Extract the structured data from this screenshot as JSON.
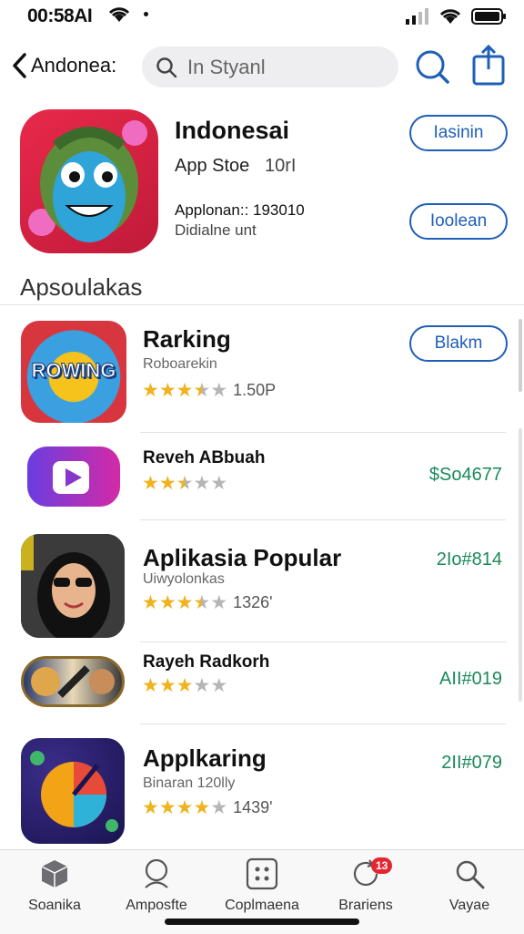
{
  "status_bar": {
    "time": "00:58AI"
  },
  "nav": {
    "back_label": "Andonea:",
    "search_placeholder": "In Styanl"
  },
  "featured": {
    "title": "Indonesai",
    "store": "App Stoe",
    "store_num": "10rI",
    "meta_line1": "Applonan:: 193010",
    "meta_line2": "Didialne unt",
    "button_primary": "Iasinin",
    "button_secondary": "Ioolean"
  },
  "section": {
    "title": "Apsoulakas"
  },
  "apps": [
    {
      "name": "Rarking",
      "subtitle": "Roboarekin",
      "rating": 3.5,
      "count": "1.50P",
      "action": "Blakm",
      "icon_text": "ROWING"
    },
    {
      "name": "Reveh ABbuah",
      "subtitle": "",
      "rating": 2.5,
      "count": "",
      "price": "$So4677"
    },
    {
      "name": "Aplikasia Popular",
      "subtitle": "Uiwyolonkas",
      "rating": 3.5,
      "count": "1326'",
      "price": "2Io#814"
    },
    {
      "name": "Rayeh Radkorh",
      "subtitle": "",
      "rating": 3,
      "count": "",
      "price": "AII#019"
    },
    {
      "name": "Applkaring",
      "subtitle": "Binaran 120lly",
      "rating": 4,
      "count": "1439'",
      "price": "2II#079"
    }
  ],
  "tab_bar": {
    "tabs": [
      {
        "label": "Soanika",
        "icon": "cube-icon"
      },
      {
        "label": "Amposfte",
        "icon": "person-icon"
      },
      {
        "label": "Coplmaena",
        "icon": "grid-icon"
      },
      {
        "label": "Brariens",
        "icon": "refresh-icon",
        "badge": "13"
      },
      {
        "label": "Vayae",
        "icon": "search-icon"
      }
    ]
  },
  "colors": {
    "accent": "#1f5fb8",
    "star": "#f0b21d",
    "price": "#1a8a5a",
    "badge": "#e3262f"
  }
}
